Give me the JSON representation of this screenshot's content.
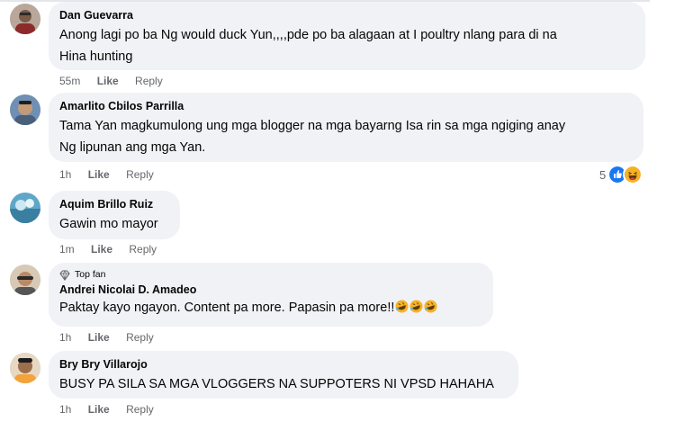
{
  "comments": [
    {
      "name": "Dan Guevarra",
      "text": "Anong lagi po ba Ng would duck Yun,,,,pde po ba alagaan at I poultry nlang para di na\nHina hunting",
      "time": "55m",
      "like": "Like",
      "reply": "Reply"
    },
    {
      "name": "Amarlito Cbilos Parrilla",
      "text": "Tama Yan magkumulong ung mga blogger na mga bayarng Isa rin sa mga ngiging anay\nNg lipunan ang mga Yan.",
      "time": "1h",
      "like": "Like",
      "reply": "Reply",
      "reaction_count": "5",
      "reactions": [
        "like-reaction-icon",
        "haha-reaction-icon"
      ]
    },
    {
      "name": "Aquim Brillo Ruiz",
      "text": "Gawin mo mayor",
      "time": "1m",
      "like": "Like",
      "reply": "Reply"
    },
    {
      "badge": "Top fan",
      "name": "Andrei Nicolai D. Amadeo",
      "text": "Paktay kayo ngayon. Content pa more. Papasin pa more!!",
      "emojis": [
        "rofl-emoji",
        "rofl-emoji",
        "rofl-emoji"
      ],
      "time": "1h",
      "like": "Like",
      "reply": "Reply"
    },
    {
      "name": "Bry Bry Villarojo",
      "text": "BUSY PA SILA SA MGA VLOGGERS NA SUPPOTERS NI VPSD HAHAHA",
      "time": "1h",
      "like": "Like",
      "reply": "Reply"
    }
  ],
  "colors": {
    "bubble": "#f0f2f5",
    "meta_text": "#65676b",
    "like_blue": "#1877f2",
    "haha_yellow": "#f7b125"
  }
}
